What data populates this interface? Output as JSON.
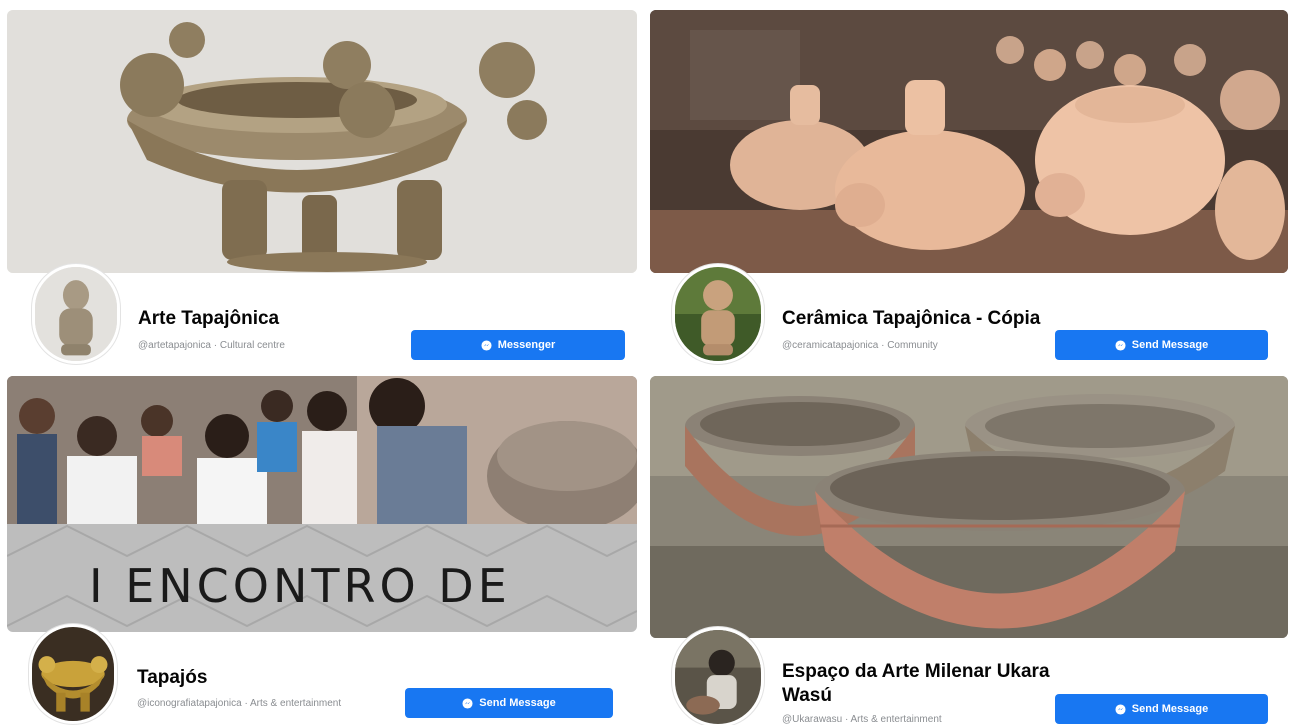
{
  "pages": [
    {
      "name": "Arte Tapajônica",
      "subtitle": "@artetapajonica · Cultural centre",
      "button_label": "Messenger",
      "button_icon": "messenger-icon"
    },
    {
      "name": "Cerâmica Tapajônica - Cópia",
      "subtitle": "@ceramicatapajonica · Community",
      "button_label": "Send Message",
      "button_icon": "messenger-icon"
    },
    {
      "name": "Tapajós",
      "subtitle": "@iconografiatapajonica · Arts & entertainment",
      "button_label": "Send Message",
      "button_icon": "messenger-icon",
      "cover_text": "I ENCONTRO DE"
    },
    {
      "name": "Espaço da Arte Milenar Ukara Wasú",
      "subtitle": "@Ukarawasu · Arts & entertainment",
      "button_label": "Send Message",
      "button_icon": "messenger-icon"
    }
  ],
  "colors": {
    "button": "#1877f2",
    "name": "#050505",
    "subtitle": "#8a8d91"
  }
}
